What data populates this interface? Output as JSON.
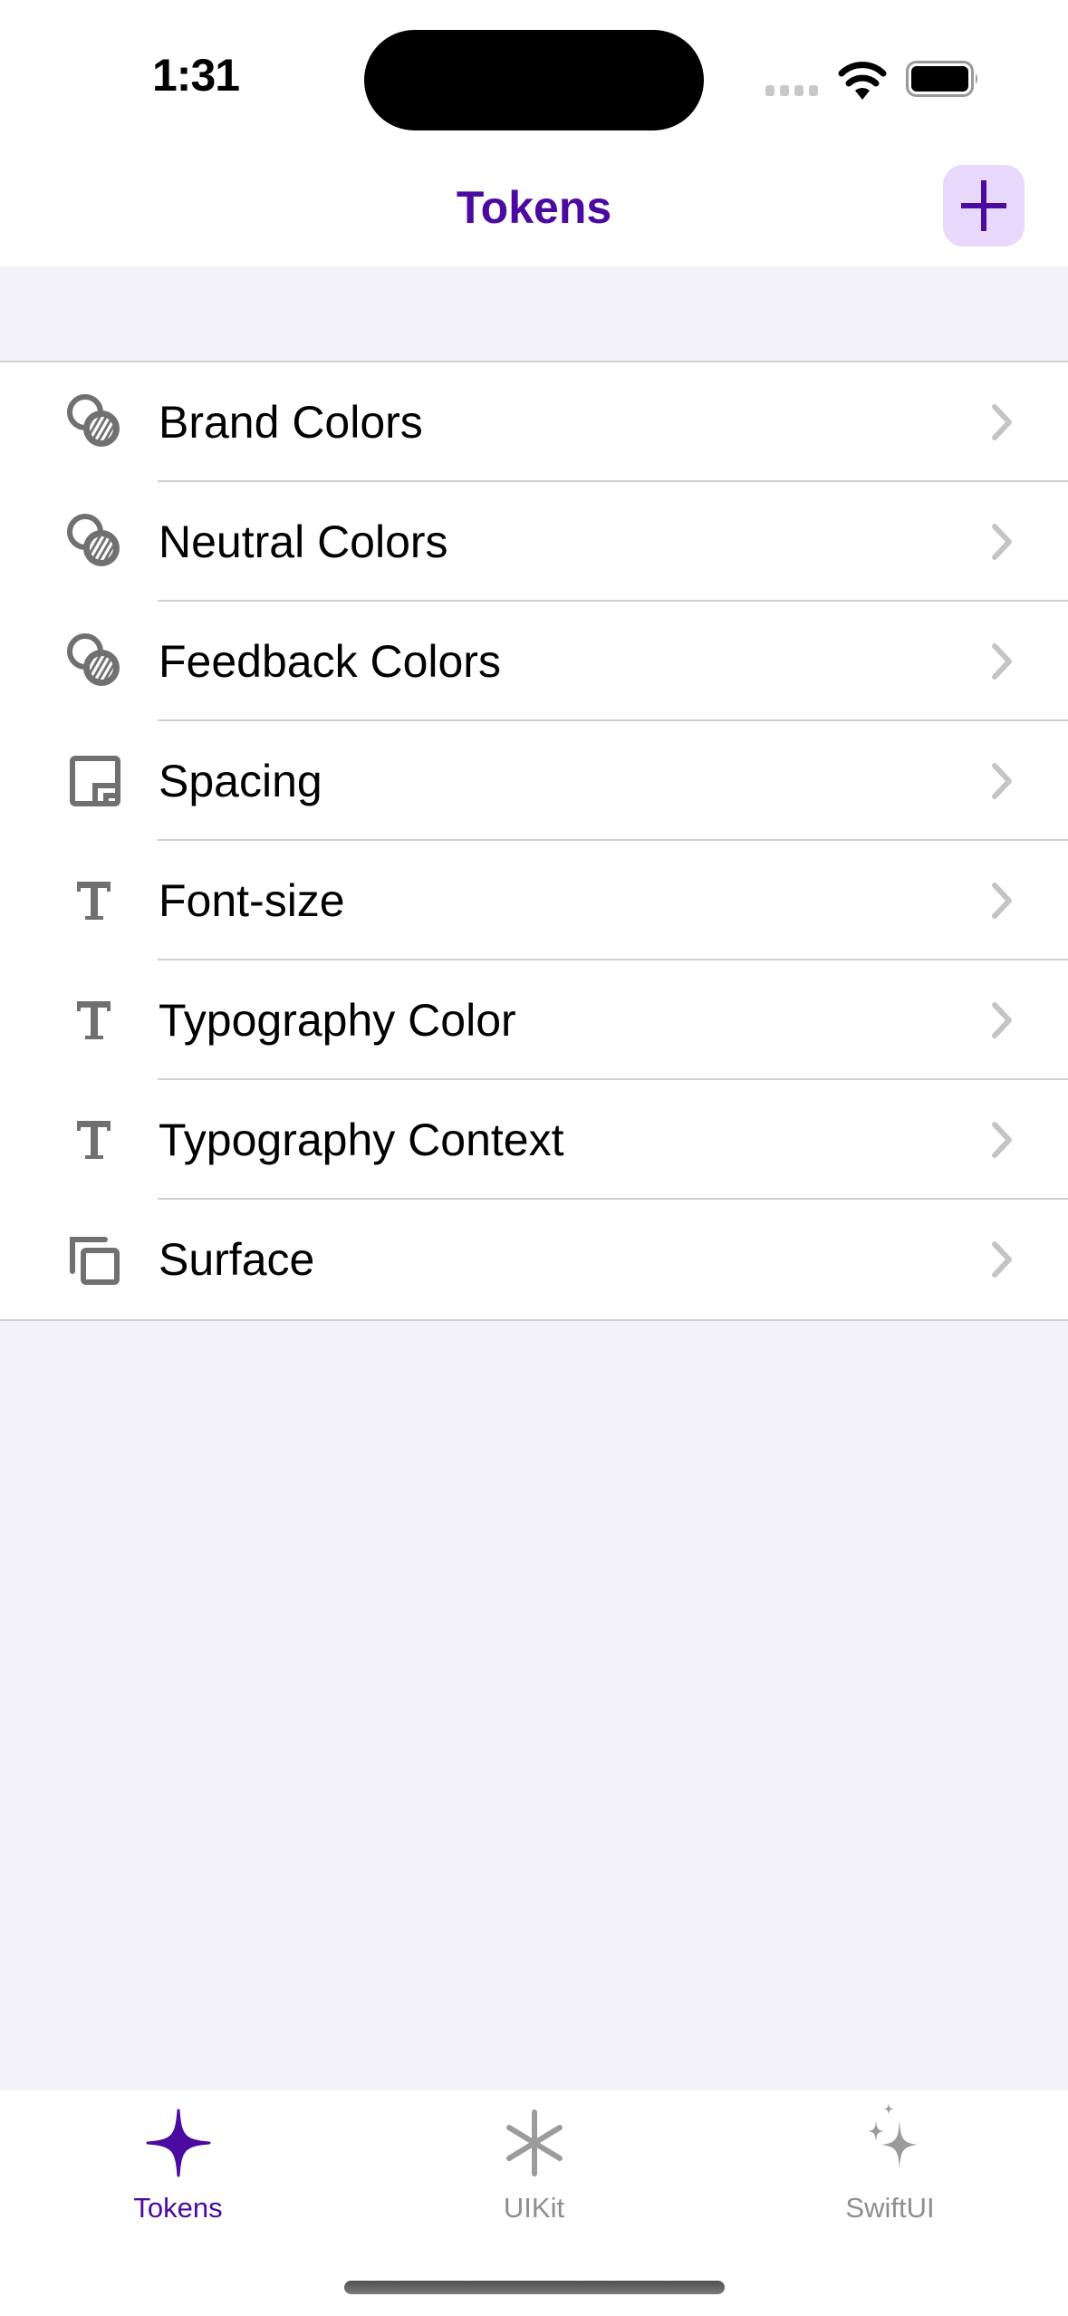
{
  "status_bar": {
    "time": "1:31",
    "icons": [
      "cellular-signal-icon",
      "wifi-icon",
      "battery-icon"
    ]
  },
  "navbar": {
    "title": "Tokens",
    "add_button_icon": "plus-icon"
  },
  "colors": {
    "accent": "#4b0aa0",
    "accent_light": "#e8d9fc",
    "icon_gray": "#707070",
    "chevron_gray": "#c4c4c7",
    "background": "#f2f2f7"
  },
  "list": {
    "items": [
      {
        "label": "Brand Colors",
        "icon": "color-circles-icon"
      },
      {
        "label": "Neutral Colors",
        "icon": "color-circles-icon"
      },
      {
        "label": "Feedback Colors",
        "icon": "color-circles-icon"
      },
      {
        "label": "Spacing",
        "icon": "spacing-square-icon"
      },
      {
        "label": "Font-size",
        "icon": "textformat-icon"
      },
      {
        "label": "Typography Color",
        "icon": "textformat-icon"
      },
      {
        "label": "Typography Context",
        "icon": "textformat-icon"
      },
      {
        "label": "Surface",
        "icon": "stacked-squares-icon"
      }
    ]
  },
  "tabbar": {
    "tabs": [
      {
        "label": "Tokens",
        "icon": "sparkle-icon",
        "active": true
      },
      {
        "label": "UIKit",
        "icon": "asterisk-icon",
        "active": false
      },
      {
        "label": "SwiftUI",
        "icon": "sparkles-icon",
        "active": false
      }
    ]
  }
}
